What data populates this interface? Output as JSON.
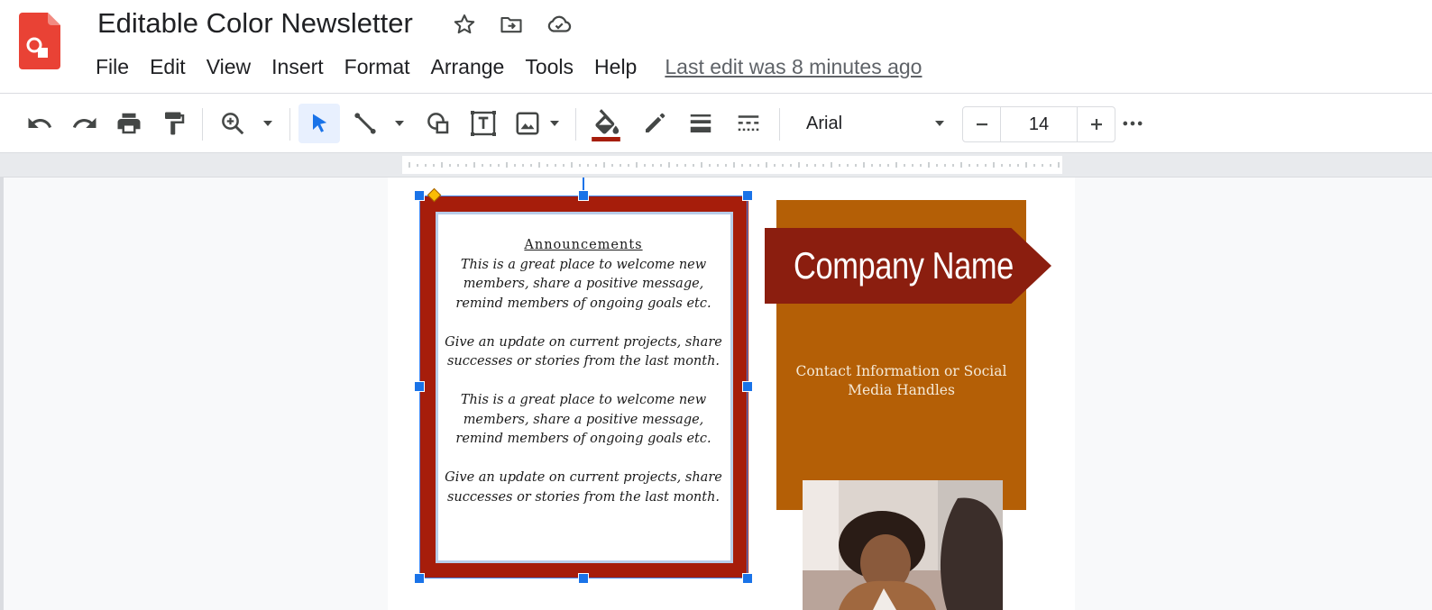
{
  "header": {
    "title": "Editable Color Newsletter",
    "icons": [
      "star-icon",
      "move-to-folder-icon",
      "cloud-saved-icon"
    ]
  },
  "menu": {
    "items": [
      "File",
      "Edit",
      "View",
      "Insert",
      "Format",
      "Arrange",
      "Tools",
      "Help"
    ],
    "last_edit": "Last edit was 8 minutes ago"
  },
  "toolbar": {
    "font": "Arial",
    "font_size": "14",
    "fill_color": "#a61d0b",
    "icons": [
      "undo-icon",
      "redo-icon",
      "print-icon",
      "paint-format-icon",
      "zoom-icon",
      "select-icon",
      "line-icon",
      "shape-icon",
      "text-box-icon",
      "image-icon",
      "fill-color-icon",
      "border-color-icon",
      "border-weight-icon",
      "border-dash-icon",
      "more-icon"
    ]
  },
  "slide": {
    "announcements": {
      "title": "Announcements",
      "paragraphs": [
        "This is a great place to welcome new members, share a positive message, remind members of ongoing goals etc.",
        "Give an update on current projects, share successes or stories from the last month.",
        "This is a great place to welcome new members, share a positive message, remind members of ongoing goals etc.",
        "Give an update on current projects, share successes or stories from the last month."
      ]
    },
    "company_name": "Company Name",
    "contact": "Contact Information or Social Media Handles",
    "colors": {
      "frame": "#a61d0b",
      "panel": "#b45f06",
      "banner": "#8b1e0f"
    }
  }
}
